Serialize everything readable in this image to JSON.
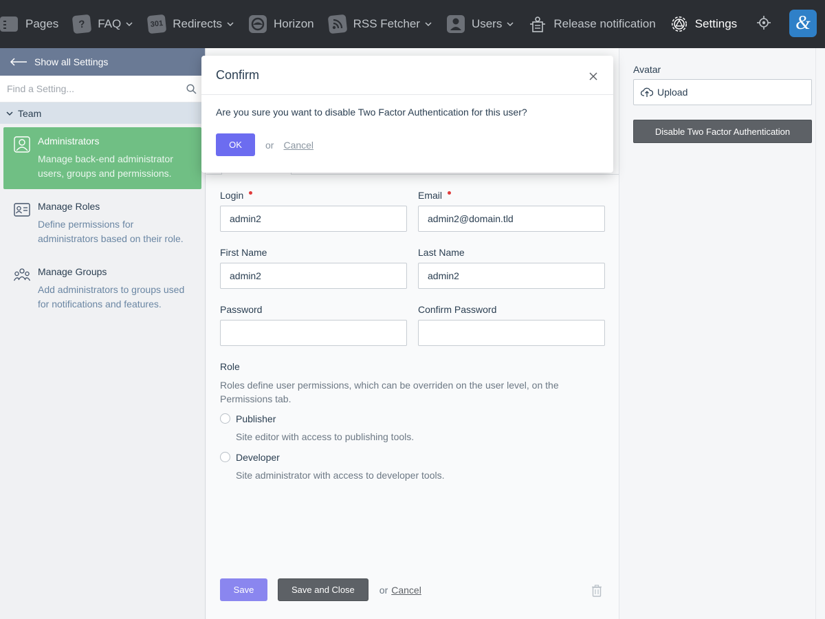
{
  "topnav": {
    "items": [
      {
        "label": "Pages",
        "icon": "pages-icon",
        "dropdown": false
      },
      {
        "label": "FAQ",
        "icon": "question-icon",
        "dropdown": true
      },
      {
        "label": "Redirects",
        "icon": "redirect-301-icon",
        "badge": "301",
        "dropdown": true
      },
      {
        "label": "Horizon",
        "icon": "horizon-icon",
        "dropdown": false
      },
      {
        "label": "RSS Fetcher",
        "icon": "rss-icon",
        "dropdown": true
      },
      {
        "label": "Users",
        "icon": "users-icon",
        "dropdown": true
      },
      {
        "label": "Release notification",
        "icon": "release-notification-icon",
        "dropdown": false
      },
      {
        "label": "Settings",
        "icon": "settings-icon",
        "dropdown": false,
        "active": true
      }
    ],
    "help_icon": "locate-icon",
    "logo_icon": "app-logo-icon",
    "faq_glyph": "?"
  },
  "sidebar": {
    "show_all": "Show all Settings",
    "search_placeholder": "Find a Setting...",
    "section": "Team",
    "items": [
      {
        "title": "Administrators",
        "desc": "Manage back-end administrator users, groups and permissions.",
        "icon": "administrator-icon",
        "active": true
      },
      {
        "title": "Manage Roles",
        "desc": "Define permissions for administrators based on their role.",
        "icon": "roles-icon",
        "active": false
      },
      {
        "title": "Manage Groups",
        "desc": "Add administrators to groups used for notifications and features.",
        "icon": "groups-icon",
        "active": false
      }
    ]
  },
  "form": {
    "login": {
      "label": "Login",
      "value": "admin2",
      "required": true
    },
    "email": {
      "label": "Email",
      "value": "admin2@domain.tld",
      "required": true
    },
    "first_name": {
      "label": "First Name",
      "value": "admin2"
    },
    "last_name": {
      "label": "Last Name",
      "value": "admin2"
    },
    "password": {
      "label": "Password",
      "value": ""
    },
    "confirm_password": {
      "label": "Confirm Password",
      "value": ""
    },
    "role": {
      "title": "Role",
      "help": "Roles define user permissions, which can be overriden on the user level, on the Permissions tab.",
      "options": [
        {
          "label": "Publisher",
          "desc": "Site editor with access to publishing tools."
        },
        {
          "label": "Developer",
          "desc": "Site administrator with access to developer tools."
        }
      ]
    },
    "actions": {
      "save": "Save",
      "save_close": "Save and Close",
      "or": "or",
      "cancel": "Cancel"
    }
  },
  "right_panel": {
    "avatar_label": "Avatar",
    "upload_label": "Upload",
    "disable_2fa_label": "Disable Two Factor Authentication"
  },
  "modal": {
    "title": "Confirm",
    "message": "Are you sure you want to disable Two Factor Authentication for this user?",
    "ok": "OK",
    "or": "or",
    "cancel": "Cancel"
  },
  "colors": {
    "topbar": "#2b2e33",
    "sidebar_active": "#70bf84",
    "primary_button": "#6c6cf0",
    "dark_button": "#5d6166",
    "show_all_bg": "#6a7a95"
  }
}
